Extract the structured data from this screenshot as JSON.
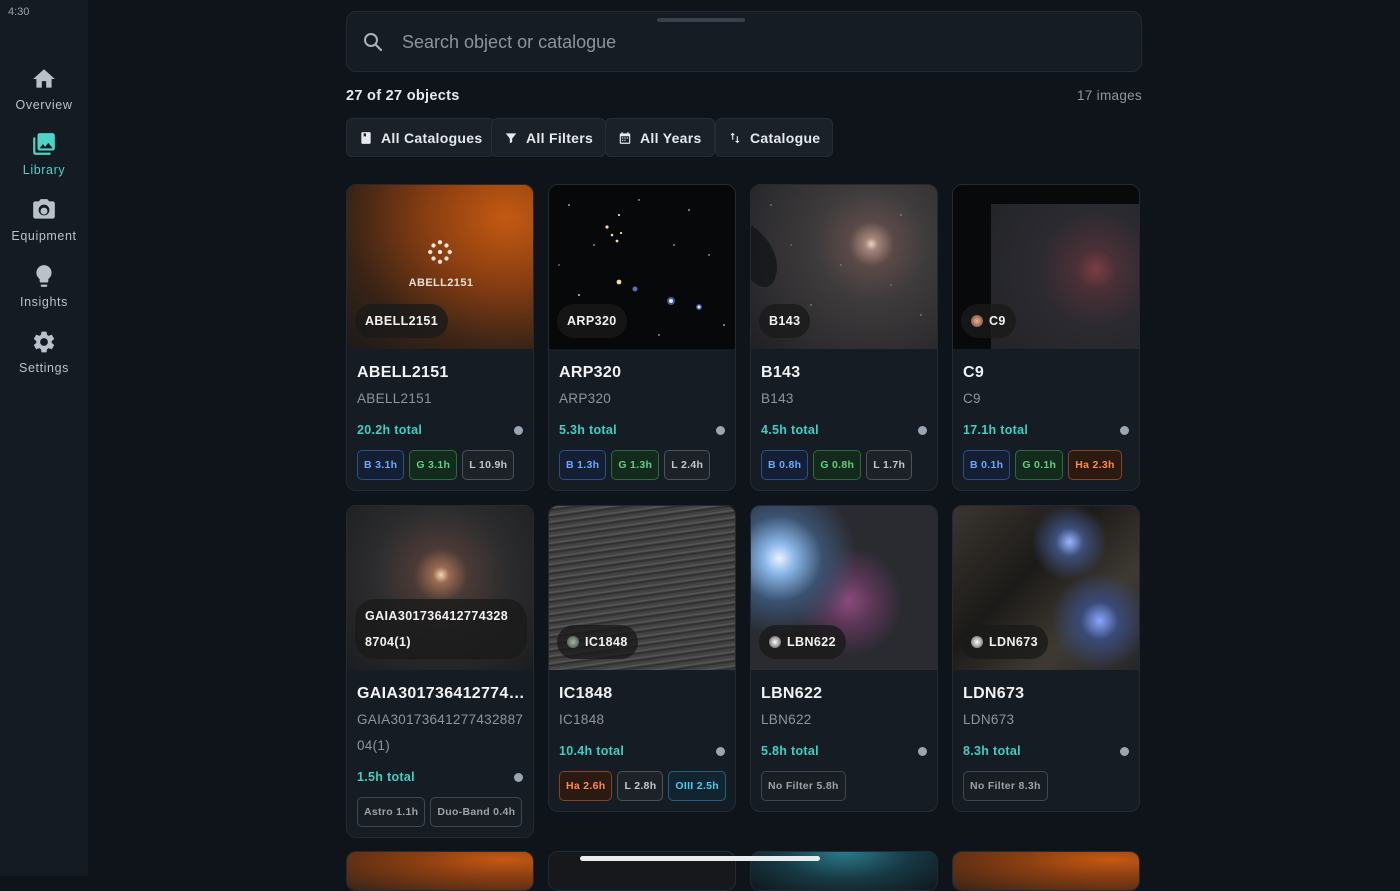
{
  "status": {
    "time": "4:30"
  },
  "nav": [
    {
      "label": "Overview",
      "icon": "home-icon",
      "active": false
    },
    {
      "label": "Library",
      "icon": "photo-library-icon",
      "active": true
    },
    {
      "label": "Equipment",
      "icon": "camera-icon",
      "active": false
    },
    {
      "label": "Insights",
      "icon": "lightbulb-icon",
      "active": false
    },
    {
      "label": "Settings",
      "icon": "gear-icon",
      "active": false
    }
  ],
  "search": {
    "placeholder": "Search object or catalogue",
    "value": ""
  },
  "summary": {
    "count": "27 of 27 objects",
    "images": "17 images"
  },
  "filters": {
    "catalogues": "All Catalogues",
    "filters": "All Filters",
    "years": "All Years",
    "sort": "Catalogue"
  },
  "colors": {
    "accent": "#4fd3c6",
    "total": "#3fcfc0",
    "background": "#0f141a",
    "card": "#161c23"
  },
  "cards": [
    {
      "thumb_label": "ABELL2151",
      "placeholder_text": "ABELL2151",
      "title": "ABELL2151",
      "sub": "ABELL2151",
      "total": "20.2h total",
      "badges": [
        {
          "text": "B 3.1h",
          "kind": "B"
        },
        {
          "text": "G 3.1h",
          "kind": "G"
        },
        {
          "text": "L 10.9h",
          "kind": "L"
        }
      ]
    },
    {
      "thumb_label": "ARP320",
      "title": "ARP320",
      "sub": "ARP320",
      "total": "5.3h total",
      "badges": [
        {
          "text": "B 1.3h",
          "kind": "B"
        },
        {
          "text": "G 1.3h",
          "kind": "G"
        },
        {
          "text": "L 2.4h",
          "kind": "L"
        }
      ]
    },
    {
      "thumb_label": "B143",
      "title": "B143",
      "sub": "B143",
      "total": "4.5h total",
      "badges": [
        {
          "text": "B 0.8h",
          "kind": "B"
        },
        {
          "text": "G 0.8h",
          "kind": "G"
        },
        {
          "text": "L 1.7h",
          "kind": "L"
        }
      ]
    },
    {
      "thumb_label": "C9",
      "title": "C9",
      "sub": "C9",
      "total": "17.1h total",
      "badges": [
        {
          "text": "B 0.1h",
          "kind": "B"
        },
        {
          "text": "G 0.1h",
          "kind": "G"
        },
        {
          "text": "Ha 2.3h",
          "kind": "Ha"
        }
      ]
    },
    {
      "thumb_label": "GAIA3017364127743288704(1)",
      "thumb_label_line1": "GAIA301736412774328",
      "thumb_label_line2": "8704(1)",
      "title": "GAIA301736412774…",
      "sub": "GAIA3017364127743288704(1)",
      "total": "1.5h total",
      "badges": [
        {
          "text": "Astro 1.1h",
          "kind": "N"
        },
        {
          "text": "Duo-Band 0.4h",
          "kind": "N"
        }
      ]
    },
    {
      "thumb_label": "IC1848",
      "title": "IC1848",
      "sub": "IC1848",
      "total": "10.4h total",
      "badges": [
        {
          "text": "Ha 2.6h",
          "kind": "Ha"
        },
        {
          "text": "L 2.8h",
          "kind": "L"
        },
        {
          "text": "OIII 2.5h",
          "kind": "O"
        }
      ]
    },
    {
      "thumb_label": "LBN622",
      "title": "LBN622",
      "sub": "LBN622",
      "total": "5.8h total",
      "badges": [
        {
          "text": "No Filter 5.8h",
          "kind": "N"
        }
      ]
    },
    {
      "thumb_label": "LDN673",
      "title": "LDN673",
      "sub": "LDN673",
      "total": "8.3h total",
      "badges": [
        {
          "text": "No Filter 8.3h",
          "kind": "N"
        }
      ]
    }
  ]
}
